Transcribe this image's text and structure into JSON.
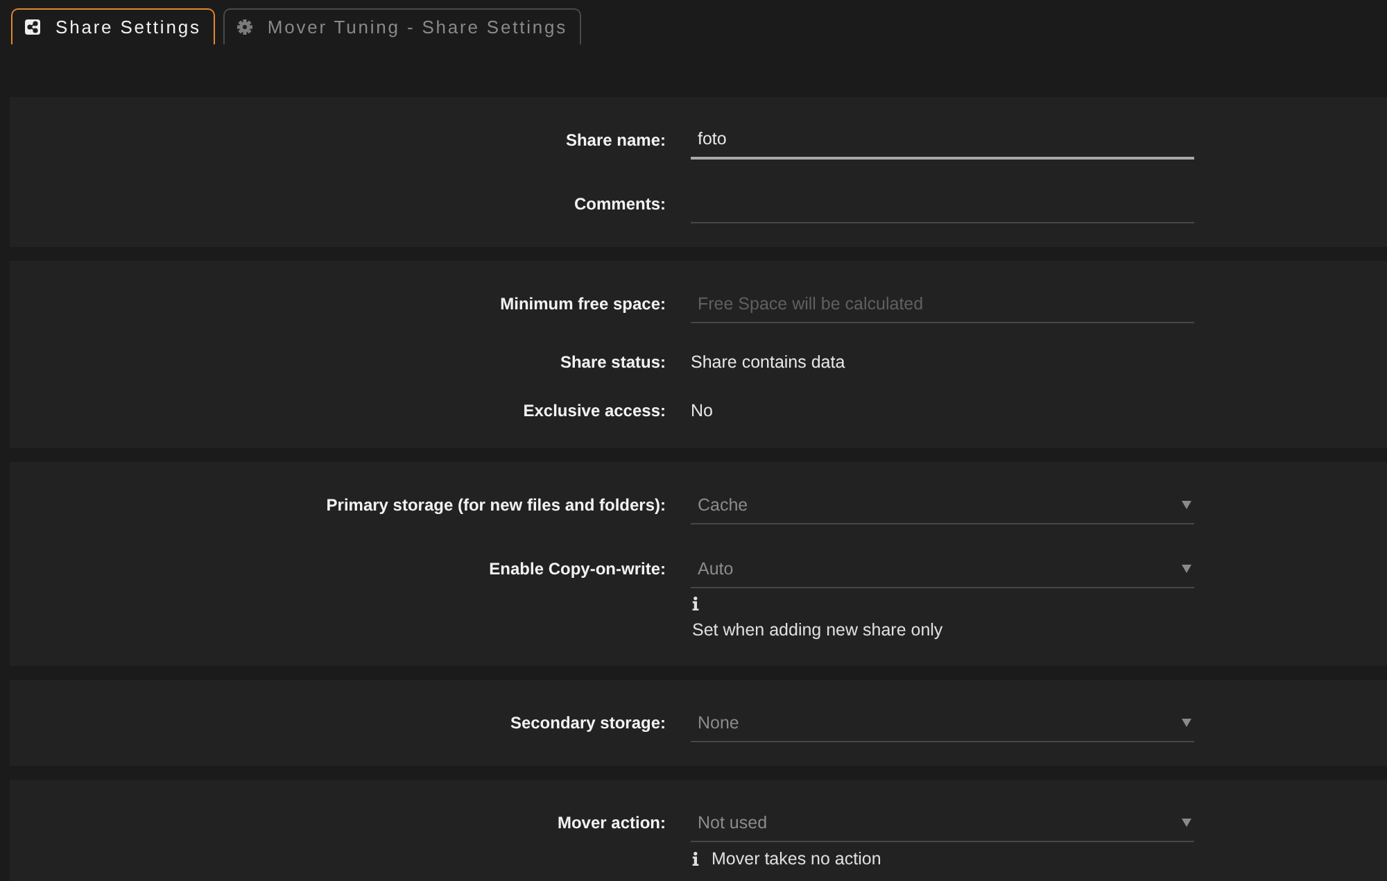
{
  "tabs": [
    {
      "label": "Share Settings",
      "selected": true
    },
    {
      "label": "Mover Tuning - Share Settings",
      "selected": false
    }
  ],
  "sections": [
    {
      "rows": [
        {
          "kind": "input",
          "label": "Share name:",
          "value": "foto",
          "focused": true
        },
        {
          "kind": "input",
          "label": "Comments:",
          "focused": false
        }
      ]
    },
    {
      "rows": [
        {
          "kind": "input",
          "label": "Minimum free space:",
          "placeholder": "Free Space will be calculated",
          "focused": false
        },
        {
          "kind": "text",
          "label": "Share status:",
          "value": "Share contains data"
        },
        {
          "kind": "text",
          "label": "Exclusive access:",
          "value": "No"
        }
      ]
    },
    {
      "rows": [
        {
          "kind": "select",
          "label": "Primary storage (for new files and folders):",
          "value": "Cache"
        },
        {
          "kind": "select",
          "label": "Enable Copy-on-write:",
          "value": "Auto",
          "note": {
            "kind": "stacked",
            "text": "Set when adding new share only"
          }
        }
      ]
    },
    {
      "rows": [
        {
          "kind": "select",
          "label": "Secondary storage:",
          "value": "None"
        }
      ]
    },
    {
      "rows": [
        {
          "kind": "select",
          "label": "Mover action:",
          "value": "Not used",
          "note": {
            "kind": "inline",
            "text": "Mover takes no action"
          }
        }
      ]
    }
  ]
}
